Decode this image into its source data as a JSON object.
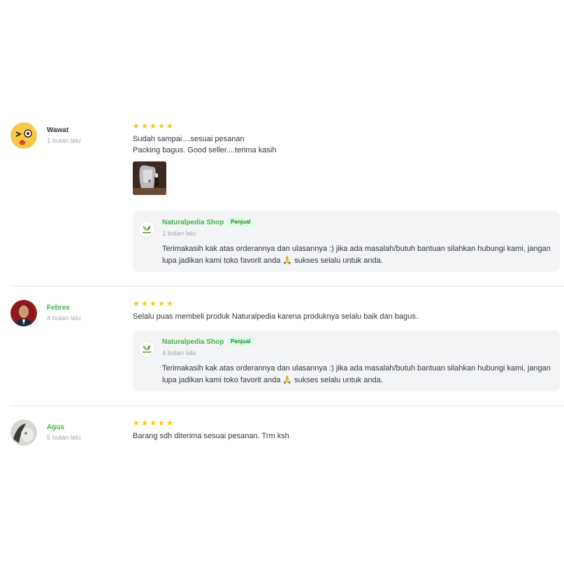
{
  "reviews": [
    {
      "name": "Wawat",
      "time": "1 bulan lalu",
      "rating": 5,
      "text_lines": [
        "Sudah sampai....sesuai pesanan",
        "Packing bagus. Good seller....terima kasih"
      ],
      "has_photo": true,
      "reply": {
        "shop_name": "Naturalpedia Shop",
        "badge": "Penjual",
        "time": "1 bulan lalu",
        "text": "Terimakasih kak atas orderannya dan ulasannya :) jika ada masalah/butuh bantuan silahkan hubungi kami, jangan lupa jadikan kami toko favorit anda 🙏 sukses selalu untuk anda."
      }
    },
    {
      "name": "Febree",
      "time": "4 bulan lalu",
      "rating": 5,
      "text_lines": [
        "Selalu puas membeli produk Naturalpedia karena produknya selalu baik dan bagus."
      ],
      "has_photo": false,
      "reply": {
        "shop_name": "Naturalpedia Shop",
        "badge": "Penjual",
        "time": "4 bulan lalu",
        "text": "Terimakasih kak atas orderannya dan ulasannya :) jika ada masalah/butuh bantuan silahkan hubungi kami, jangan lupa jadikan kami toko favorit anda 🙏 sukses selalu untuk anda."
      }
    },
    {
      "name": "Agus",
      "time": "5 bulan lalu",
      "rating": 5,
      "text_lines": [
        "Barang sdh diterima sesuai pesanan. Trm ksh"
      ],
      "has_photo": false,
      "reply": null
    }
  ],
  "colors": {
    "star": "#ffc400",
    "shop_green": "#42b549",
    "reply_bg": "#f3f4f5",
    "badge_bg": "#d6ffde"
  },
  "icons": {
    "star": "star-icon",
    "verified_leaf": "leaf-logo-icon"
  }
}
